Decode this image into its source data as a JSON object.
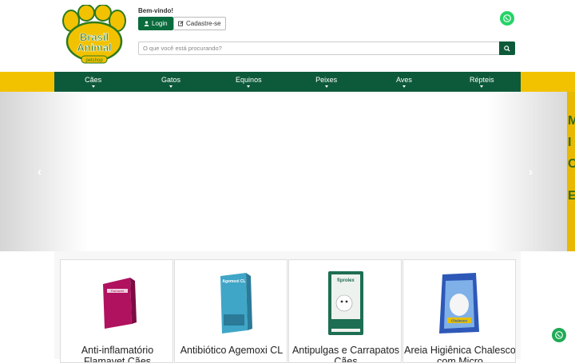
{
  "header": {
    "logo": {
      "line1": "Brasil",
      "line2": "Animal",
      "tag": "petshop"
    },
    "welcome": "Bem-vindo!",
    "login_label": "Login",
    "signup_label": "Cadastre-se",
    "search_placeholder": "O que você está procurando?"
  },
  "nav": {
    "items": [
      {
        "label": "Cães"
      },
      {
        "label": "Gatos"
      },
      {
        "label": "Equinos"
      },
      {
        "label": "Peixes"
      },
      {
        "label": "Aves"
      },
      {
        "label": "Répteis"
      }
    ]
  },
  "banner": {
    "prev_icon": "chevron-left-icon",
    "next_icon": "chevron-right-icon"
  },
  "products": [
    {
      "name": "Anti-inflamatório Flamavet Cães",
      "box_label": "Flamavet",
      "color": "#b0125f"
    },
    {
      "name": "Antibiótico Agemoxi CL",
      "box_label": "Agemoxi CL",
      "color": "#3fa6c8"
    },
    {
      "name": "Antipulgas e Carrapatos Cães",
      "box_label": "fiprolex",
      "color": "#1d6e52"
    },
    {
      "name": "Areia Higiênica Chalesco com Micro",
      "box_label": "Chalesco",
      "color": "#2e58b8"
    }
  ],
  "colors": {
    "brand_green": "#0d5a3a",
    "brand_yellow": "#f2c200",
    "whatsapp": "#25d366"
  }
}
